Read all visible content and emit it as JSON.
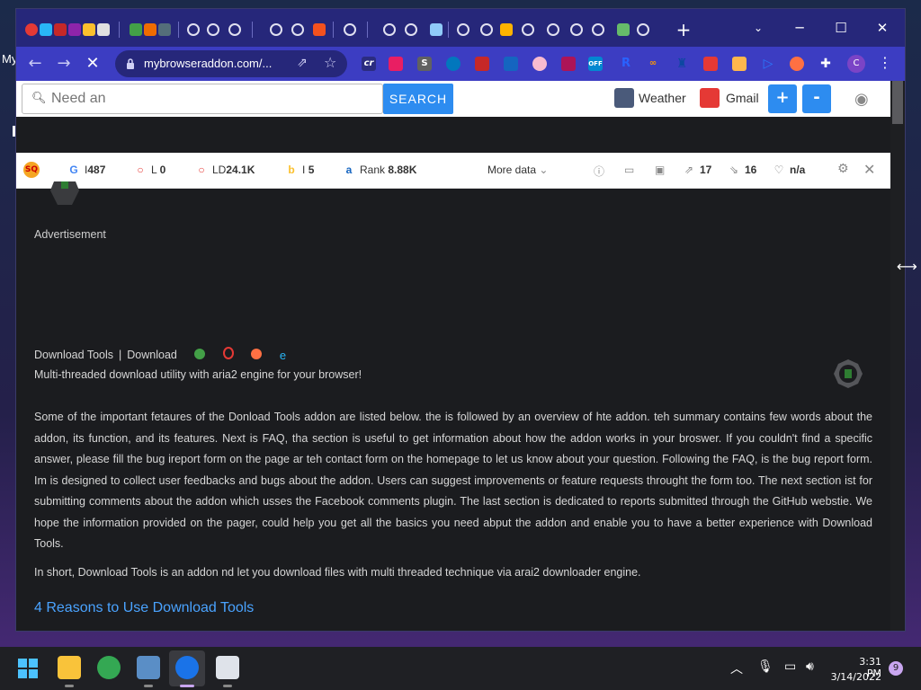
{
  "desktop": {
    "label": "My"
  },
  "window": {
    "new_tab": "+",
    "minimize": "─",
    "maximize": "☐",
    "close": "✕"
  },
  "toolbar": {
    "back": "←",
    "forward": "→",
    "stop": "✕",
    "url": "mybrowseraddon.com/...",
    "share": "⇗",
    "star": "☆",
    "profile": "C",
    "menu": "⋮"
  },
  "searchbar": {
    "placeholder": "Need an",
    "button": "SEARCH",
    "weather": "Weather",
    "gmail": "Gmail",
    "zoom_in": "+",
    "zoom_out": "-"
  },
  "seo": {
    "logo": "SQ",
    "google_label": "I",
    "google_value": "487",
    "l_label": "L",
    "l_value": "0",
    "ld_label": "LD",
    "ld_value": "24.1K",
    "bing_label": "I",
    "bing_value": "5",
    "rank_label": "Rank",
    "rank_value": "8.88K",
    "more": "More data",
    "ext_links": "17",
    "int_links": "16",
    "na": "n/a"
  },
  "page": {
    "advertisement": "Advertisement",
    "breadcrumb_a": "Download Tools",
    "breadcrumb_sep": "|",
    "breadcrumb_b": "Download",
    "tagline": "Multi-threaded download utility with aria2 engine for your browser!",
    "para1": "Some of the important fetaures of the Donload Tools addon are listed below. the is followed by an overview of hte addon. teh summary contains few words about the addon, its function, and its features. Next is FAQ, tha section is useful to get information about how the addon works in your broswer. If you couldn't find a specific answer, please fill the bug ireport form on the page ar teh contact form on the homepage to let us know about your question. Following the FAQ, is the bug report form. Im is designed to collect user feedbacks and bugs about the addon. Users can suggest improvements or feature requests throught the form too. The next section ist for submitting comments about the addon which usses the Facebook comments plugin. The last section is dedicated to reports submitted through the GitHub webstie. We hope the information provided on the pager, could help you get all the basics you need abput the addon and enable you to have a better experience with Download Tools.",
    "para2": "In short, Download Tools is an addon nd let you download files with multi threaded technique via arai2 downloader engine.",
    "heading": "4 Reasons to Use Download Tools"
  },
  "taskbar": {
    "time": "3:31 PM",
    "date": "3/14/2022",
    "notifications": "9"
  }
}
